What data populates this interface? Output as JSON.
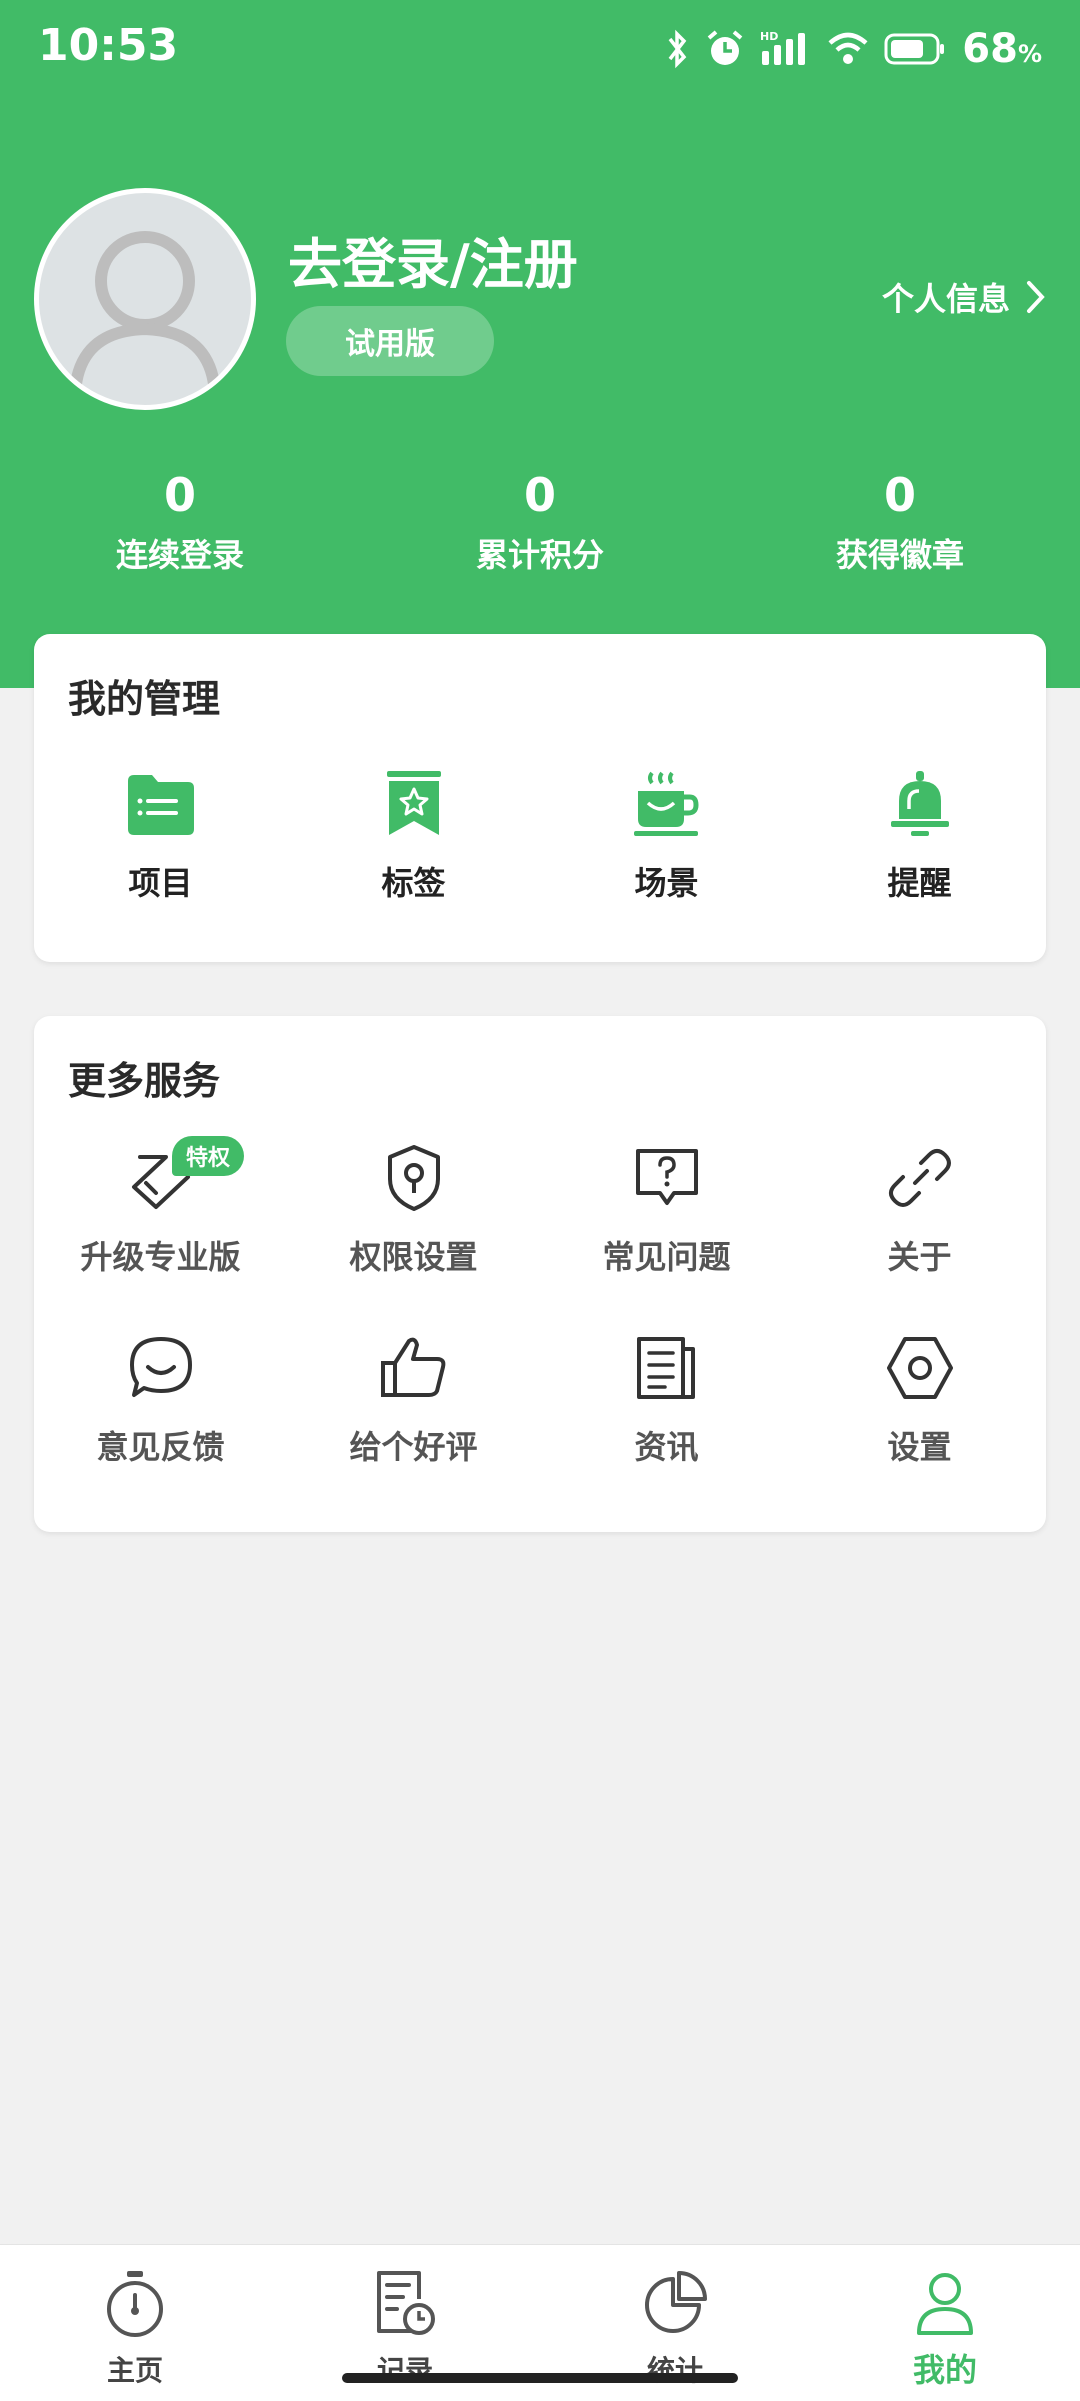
{
  "status_bar": {
    "time": "10:53",
    "battery_percent": "68",
    "battery_unit": "%"
  },
  "profile": {
    "login_text": "去登录/注册",
    "trial_badge": "试用版",
    "info_link": "个人信息"
  },
  "stats": [
    {
      "value": "0",
      "label": "连续登录"
    },
    {
      "value": "0",
      "label": "累计积分"
    },
    {
      "value": "0",
      "label": "获得徽章"
    }
  ],
  "management": {
    "title": "我的管理",
    "items": [
      {
        "label": "项目",
        "icon": "folder-icon"
      },
      {
        "label": "标签",
        "icon": "bookmark-star-icon"
      },
      {
        "label": "场景",
        "icon": "coffee-cup-icon"
      },
      {
        "label": "提醒",
        "icon": "bell-icon"
      }
    ]
  },
  "services": {
    "title": "更多服务",
    "privilege_badge": "特权",
    "items": [
      {
        "label": "升级专业版",
        "icon": "diamond-icon"
      },
      {
        "label": "权限设置",
        "icon": "shield-key-icon"
      },
      {
        "label": "常见问题",
        "icon": "question-chat-icon"
      },
      {
        "label": "关于",
        "icon": "link-icon"
      },
      {
        "label": "意见反馈",
        "icon": "feedback-chat-icon"
      },
      {
        "label": "给个好评",
        "icon": "thumbs-up-icon"
      },
      {
        "label": "资讯",
        "icon": "news-icon"
      },
      {
        "label": "设置",
        "icon": "settings-hex-icon"
      }
    ]
  },
  "tabbar": {
    "items": [
      {
        "label": "主页",
        "icon": "stopwatch-icon",
        "active": false
      },
      {
        "label": "记录",
        "icon": "record-clock-icon",
        "active": false
      },
      {
        "label": "统计",
        "icon": "pie-chart-icon",
        "active": false
      },
      {
        "label": "我的",
        "icon": "user-icon",
        "active": true
      }
    ]
  },
  "colors": {
    "accent": "#41bb67",
    "background": "#f1f1f1"
  }
}
